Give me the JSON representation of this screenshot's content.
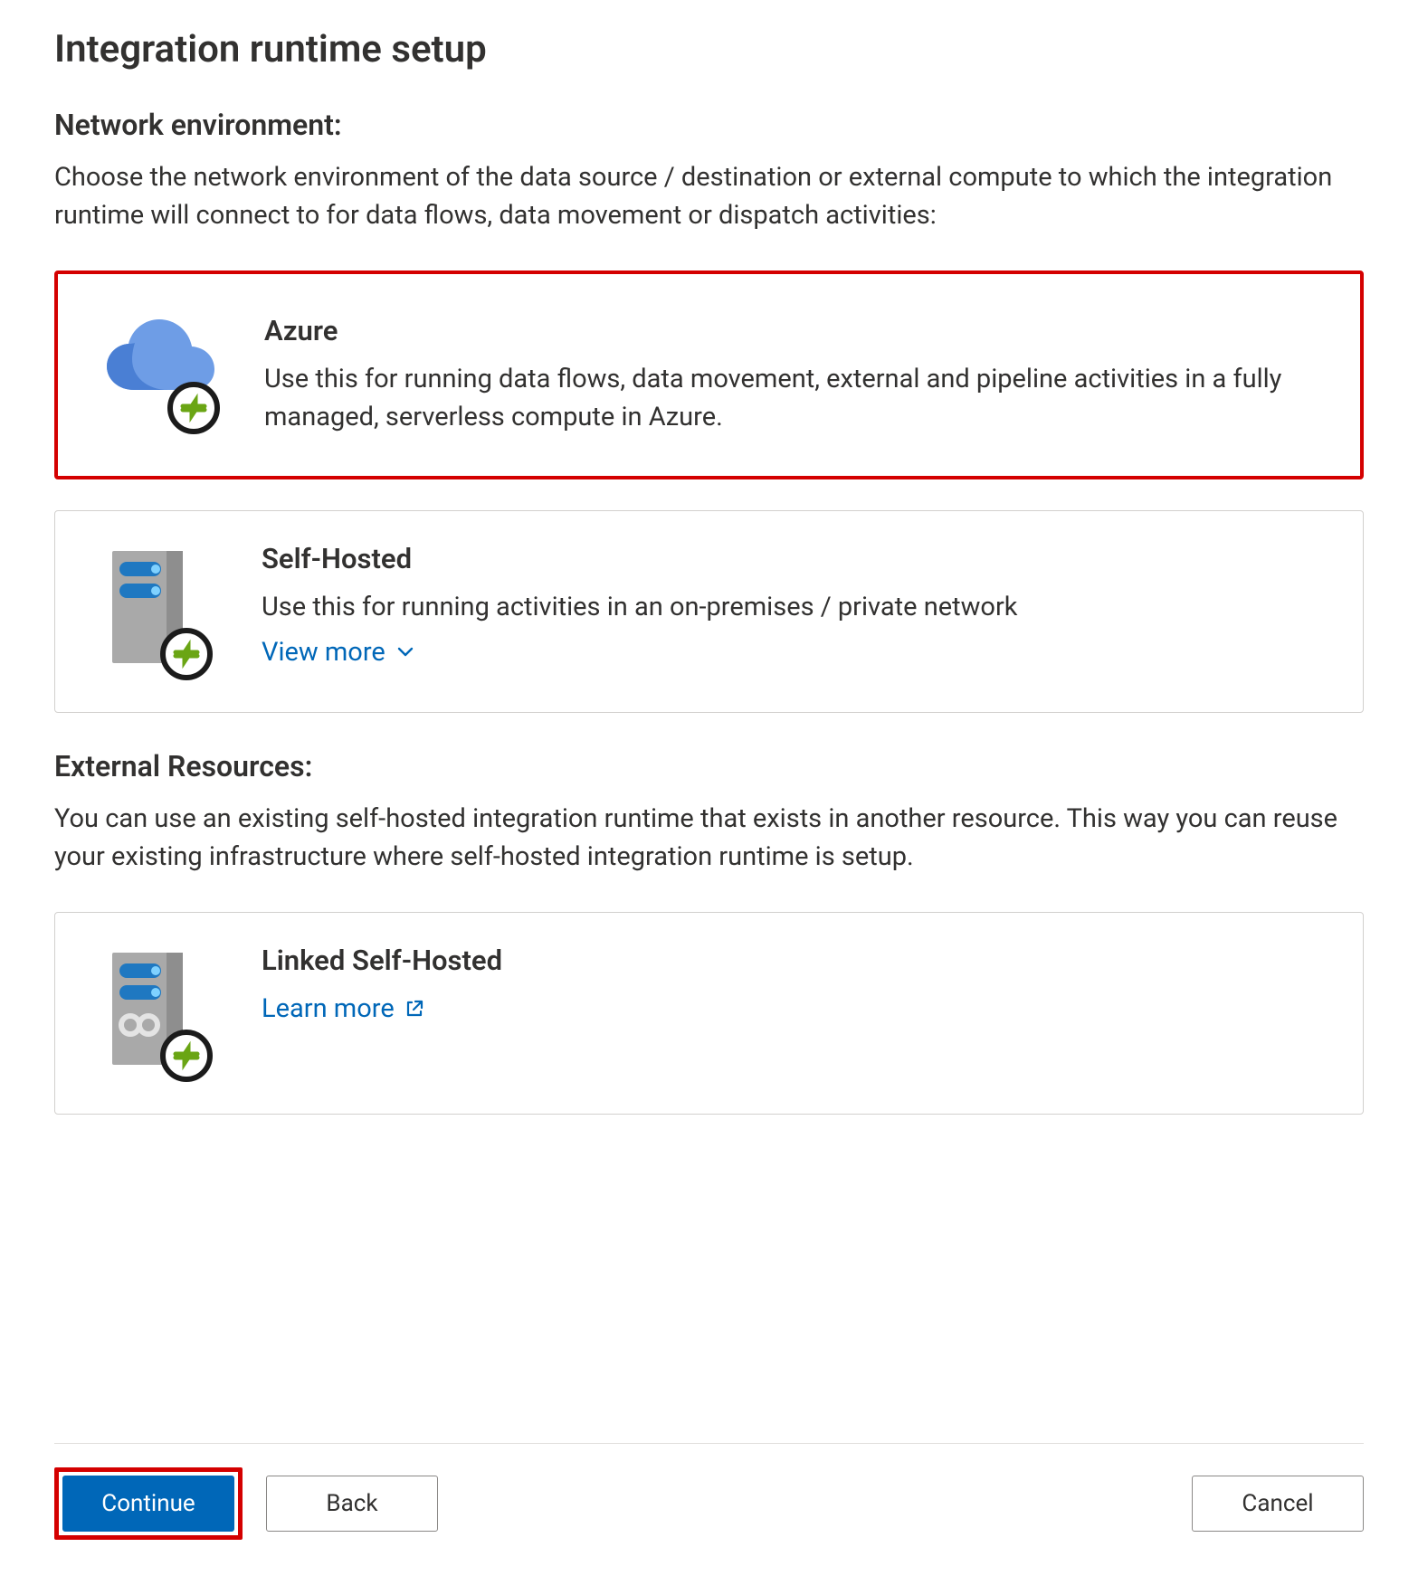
{
  "title": "Integration runtime setup",
  "sections": {
    "network": {
      "heading": "Network environment:",
      "description": "Choose the network environment of the data source / destination or external compute to which the integration runtime will connect to for data flows, data movement or dispatch activities:"
    },
    "external": {
      "heading": "External Resources:",
      "description": "You can use an existing self-hosted integration runtime that exists in another resource. This way you can reuse your existing infrastructure where self-hosted integration runtime is setup."
    }
  },
  "options": {
    "azure": {
      "title": "Azure",
      "text": "Use this for running data flows, data movement, external and pipeline activities in a fully managed, serverless compute in Azure."
    },
    "self_hosted": {
      "title": "Self-Hosted",
      "text": "Use this for running activities in an on-premises / private network",
      "view_more": "View more"
    },
    "linked_self_hosted": {
      "title": "Linked Self-Hosted",
      "learn_more": "Learn more"
    }
  },
  "footer": {
    "continue": "Continue",
    "back": "Back",
    "cancel": "Cancel"
  }
}
